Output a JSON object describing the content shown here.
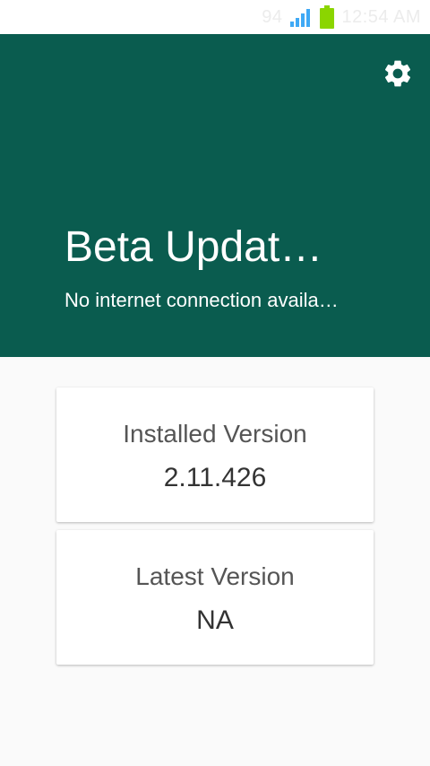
{
  "status_bar": {
    "carrier": "94",
    "time": "12:54 AM",
    "icons": [
      "signal-icon",
      "battery-icon"
    ],
    "battery_color": "#8bd500",
    "signal_color": "#3fa9f5"
  },
  "header": {
    "background_color": "#0a5c4f",
    "title": "Beta Updat…",
    "subtitle": "No internet connection availa…",
    "settings_icon": "gear-icon"
  },
  "cards": {
    "installed": {
      "label": "Installed Version",
      "value": "2.11.426"
    },
    "latest": {
      "label": "Latest Version",
      "value": "NA"
    }
  }
}
